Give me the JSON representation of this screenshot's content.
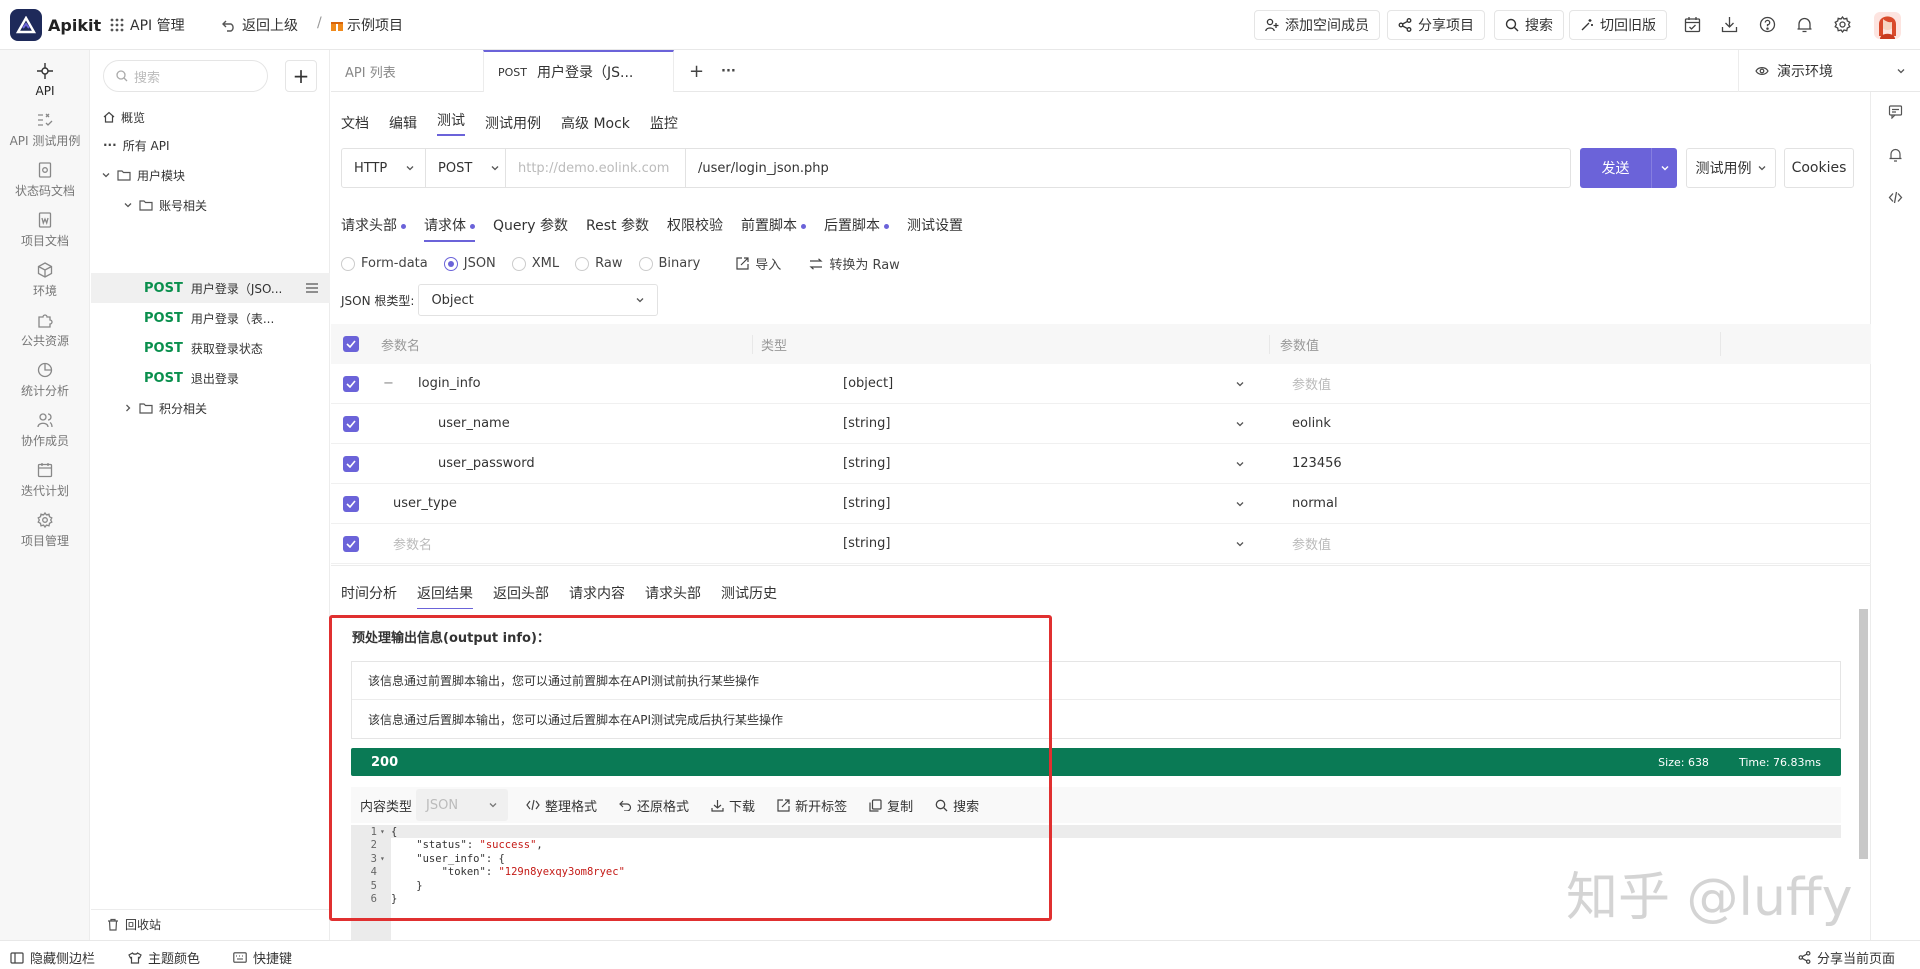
{
  "topbar": {
    "app_name": "Apikit",
    "api_manage": "API 管理",
    "back": "返回上级",
    "sep": "/",
    "project": "示例项目",
    "add_member": "添加空间成员",
    "share_project": "分享项目",
    "search": "搜索",
    "switch_old": "切回旧版"
  },
  "rail": {
    "items": [
      "API",
      "API 测试用例",
      "状态码文档",
      "项目文档",
      "环境",
      "公共资源",
      "统计分析",
      "协作成员",
      "迭代计划",
      "项目管理"
    ]
  },
  "tree": {
    "search_placeholder": "搜索",
    "overview": "概览",
    "all_api": "所有 API",
    "user_module": "用户模块",
    "account_related": "账号相关",
    "method": "POST",
    "apis": [
      "用户登录（JSO...",
      "用户登录（表...",
      "获取登录状态",
      "退出登录"
    ],
    "points_related": "积分相关",
    "recycle": "回收站"
  },
  "tabs": {
    "api_list": "API 列表",
    "current_method": "POST",
    "current_name": "用户登录（JS...",
    "add": "+",
    "more": "···",
    "env": "演示环境"
  },
  "subtabs": [
    "文档",
    "编辑",
    "测试",
    "测试用例",
    "高级 Mock",
    "监控"
  ],
  "url": {
    "protocol": "HTTP",
    "method": "POST",
    "host_placeholder": "http://demo.eolink.com",
    "path": "/user/login_json.php",
    "send": "发送",
    "test_case": "测试用例",
    "cookies": "Cookies"
  },
  "req_tabs": [
    "请求头部",
    "请求体",
    "Query 参数",
    "Rest 参数",
    "权限校验",
    "前置脚本",
    "后置脚本",
    "测试设置"
  ],
  "body_types": [
    "Form-data",
    "JSON",
    "XML",
    "Raw",
    "Binary"
  ],
  "body_actions": {
    "import": "导入",
    "to_raw": "转换为 Raw"
  },
  "json_root": {
    "label": "JSON 根类型:",
    "value": "Object"
  },
  "param_table": {
    "headers": [
      "参数名",
      "类型",
      "参数值"
    ],
    "rows": [
      {
        "name": "login_info",
        "type": "[object]",
        "value": "参数值"
      },
      {
        "name": "user_name",
        "type": "[string]",
        "value": "eolink"
      },
      {
        "name": "user_password",
        "type": "[string]",
        "value": "123456"
      },
      {
        "name": "user_type",
        "type": "[string]",
        "value": "normal"
      },
      {
        "name": "参数名",
        "type": "[string]",
        "value": "参数值"
      }
    ]
  },
  "result_tabs": [
    "时间分析",
    "返回结果",
    "返回头部",
    "请求内容",
    "请求头部",
    "测试历史"
  ],
  "output": {
    "title": "预处理输出信息(output info)：",
    "pre_msg": "该信息通过前置脚本输出，您可以通过前置脚本在API测试前执行某些操作",
    "post_msg": "该信息通过后置脚本输出，您可以通过后置脚本在API测试完成后执行某些操作"
  },
  "status": {
    "code": "200",
    "size": "Size:  638",
    "time": "Time:  76.83ms"
  },
  "toolbar": {
    "content_type_label": "内容类型",
    "content_type": "JSON",
    "format": "整理格式",
    "restore": "还原格式",
    "download": "下载",
    "new_tab": "新开标签",
    "copy": "复制",
    "search": "搜索"
  },
  "code_lines": [
    {
      "n": "1",
      "text": "{"
    },
    {
      "n": "2",
      "text": "    \"status\": \"success\","
    },
    {
      "n": "3",
      "text": "    \"user_info\": {"
    },
    {
      "n": "4",
      "text": "        \"token\": \"129n8yexqy3om8ryec\""
    },
    {
      "n": "5",
      "text": "    }"
    },
    {
      "n": "6",
      "text": "}"
    }
  ],
  "watermark": "知乎 @luffy",
  "bottom": {
    "hide_sidebar": "隐藏侧边栏",
    "theme": "主题颜色",
    "shortcuts": "快捷键",
    "share_page": "分享当前页面"
  },
  "colors": {
    "accent": "#6b63d9",
    "success": "#0a7a55",
    "post": "#0a8f4d",
    "highlight_box": "#e03030"
  }
}
